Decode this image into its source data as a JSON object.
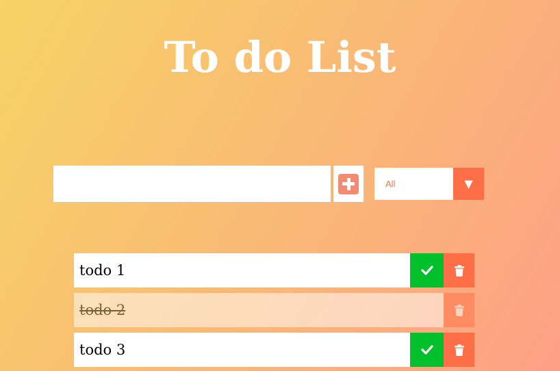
{
  "app": {
    "title": "To do List"
  },
  "form": {
    "input_value": "",
    "input_placeholder": "",
    "add_icon": "plus-square-icon"
  },
  "filter": {
    "selected": "All",
    "arrow_icon": "caret-down-icon"
  },
  "todos": [
    {
      "text": "todo 1",
      "completed": false
    },
    {
      "text": "todo 2",
      "completed": true
    },
    {
      "text": "todo 3",
      "completed": false
    }
  ],
  "colors": {
    "gradient_start": "#f6d365",
    "gradient_end": "#fda085",
    "accent": "#ff6f47",
    "complete": "#00c12b",
    "add_button": "#f38b72"
  }
}
